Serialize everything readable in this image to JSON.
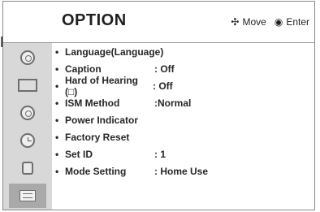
{
  "header": {
    "title": "OPTION",
    "move_label": "Move",
    "enter_label": "Enter",
    "move_icon": "move-arrows-icon",
    "enter_icon": "enter-icon"
  },
  "sidebar": {
    "items": [
      {
        "icon": "option-icon",
        "selected": false
      },
      {
        "icon": "picture-icon",
        "selected": false
      },
      {
        "icon": "screen-icon",
        "selected": false
      },
      {
        "icon": "audio-icon",
        "selected": false
      },
      {
        "icon": "clock-icon",
        "selected": false
      },
      {
        "icon": "lock-icon",
        "selected": false
      },
      {
        "icon": "option-icon",
        "selected": true
      }
    ]
  },
  "menu": {
    "items": [
      {
        "label": "Language(Language)",
        "value": ""
      },
      {
        "label": "Caption",
        "value": ": Off"
      },
      {
        "label": "Hard of Hearing (□)",
        "value": ": Off"
      },
      {
        "label": "ISM Method",
        "value": ":Normal"
      },
      {
        "label": "Power Indicator",
        "value": ""
      },
      {
        "label": "Factory Reset",
        "value": ""
      },
      {
        "label": "Set ID",
        "value": ": 1"
      },
      {
        "label": "Mode Setting",
        "value": ": Home Use"
      }
    ]
  },
  "edge": {
    "left_glyph": "R."
  }
}
